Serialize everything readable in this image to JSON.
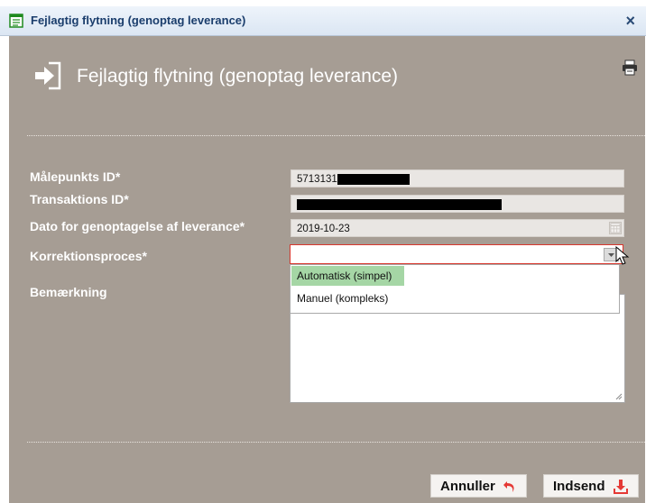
{
  "window": {
    "title": "Fejlagtig flytning (genoptag leverance)",
    "close_glyph": "×"
  },
  "header": {
    "title": "Fejlagtig flytning (genoptag leverance)"
  },
  "form": {
    "malepunkt_label": "Målepunkts ID*",
    "malepunkt_value": "5713131",
    "transaktion_label": "Transaktions ID*",
    "dato_label": "Dato for genoptagelse af leverance*",
    "dato_value": "2019-10-23",
    "korrektion_label": "Korrektionsproces*",
    "korrektion_value": "",
    "korrektion_options": [
      "Automatisk (simpel)",
      "Manuel (kompleks)"
    ],
    "bemaerkning_label": "Bemærkning",
    "bemaerkning_value": ""
  },
  "buttons": {
    "cancel_label": "Annuller",
    "submit_label": "Indsend"
  },
  "colors": {
    "panel": "#a69d94",
    "selected_option": "#a5d6a5",
    "error_border": "#d8362d",
    "cancel_icon": "#e53935",
    "submit_icon": "#e53935"
  },
  "icons": {
    "window": "form-icon",
    "header": "move-in-icon",
    "print": "printer-icon",
    "calendar": "calendar-icon",
    "cancel": "undo-arrow-icon",
    "submit": "download-icon"
  }
}
